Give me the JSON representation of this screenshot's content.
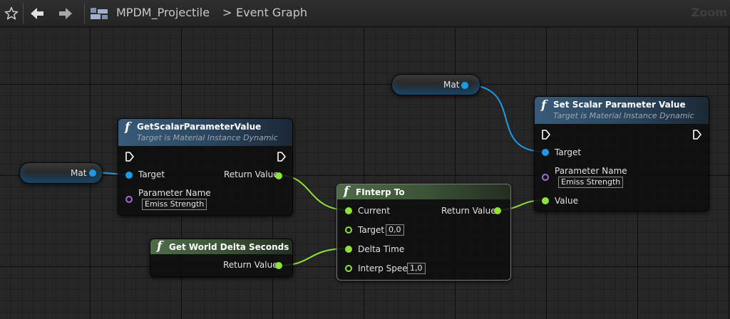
{
  "toolbar": {
    "breadcrumb_root": "MPDM_Projectile",
    "breadcrumb_separator": ">",
    "breadcrumb_current": "Event Graph",
    "zoom_label": "Zoom"
  },
  "icons": [
    "star-icon",
    "back-arrow-icon",
    "forward-arrow-icon",
    "blueprint-graph-icon",
    "exec-pin-icon",
    "function-icon"
  ],
  "colors": {
    "object_pin": "#1e9be8",
    "float_pin": "#8ee23a",
    "name_pin": "#a66ad6",
    "exec_pin": "#ffffff"
  },
  "nodes": {
    "get_scalar": {
      "title": "GetScalarParameterValue",
      "subtitle": "Target is Material Instance Dynamic",
      "target_label": "Target",
      "param_label": "Parameter Name",
      "param_value": "Emiss Strength",
      "return_label": "Return Value"
    },
    "mat_var_left": {
      "label": "Mat"
    },
    "mat_var_top": {
      "label": "Mat"
    },
    "set_scalar": {
      "title": "Set Scalar Parameter Value",
      "subtitle": "Target is Material Instance Dynamic",
      "target_label": "Target",
      "param_label": "Parameter Name",
      "param_value": "Emiss Strength",
      "value_label": "Value"
    },
    "finterp": {
      "title": "FInterp To",
      "current_label": "Current",
      "target_label": "Target",
      "target_value": "0,0",
      "delta_label": "Delta Time",
      "speed_label": "Interp Speed",
      "speed_value": "1,0",
      "return_label": "Return Value"
    },
    "world_delta": {
      "title": "Get World Delta Seconds",
      "return_label": "Return Value"
    }
  }
}
